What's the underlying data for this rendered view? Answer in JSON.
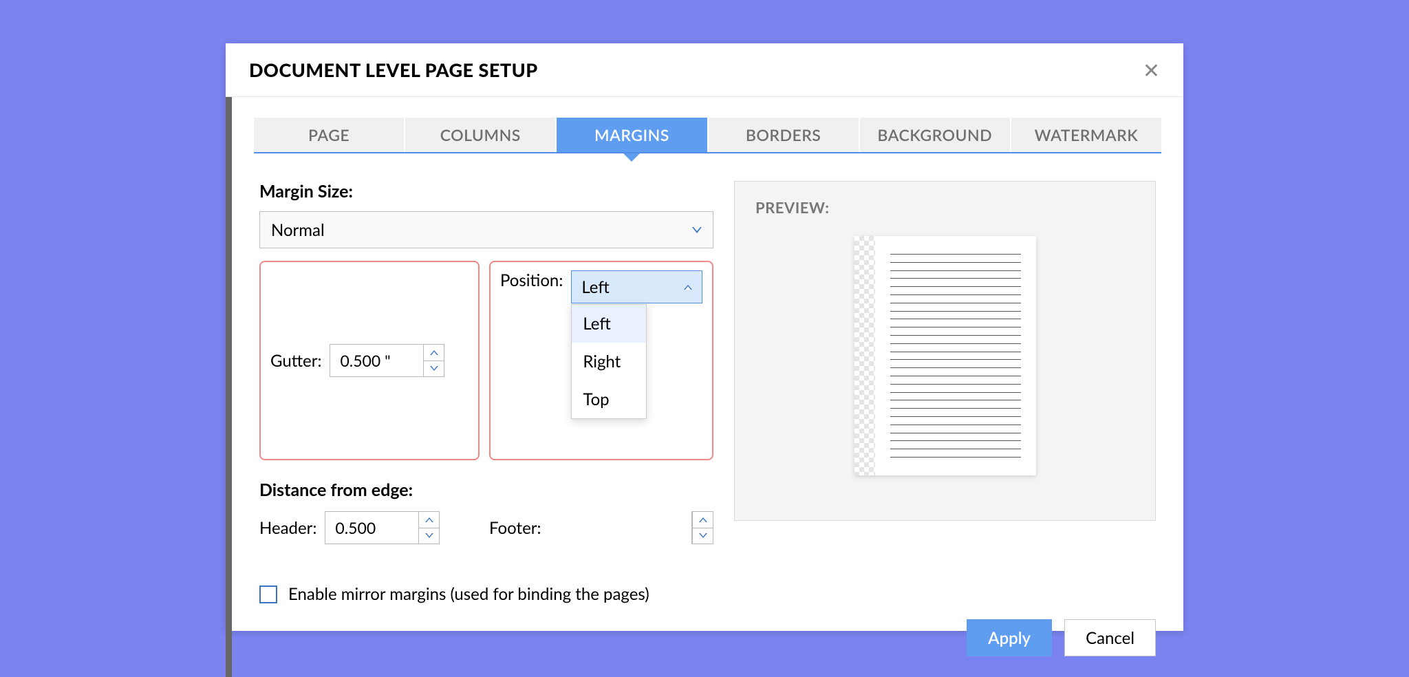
{
  "dialog": {
    "title": "DOCUMENT LEVEL PAGE SETUP"
  },
  "tabs": [
    "PAGE",
    "COLUMNS",
    "MARGINS",
    "BORDERS",
    "BACKGROUND",
    "WATERMARK"
  ],
  "active_tab_index": 2,
  "margins": {
    "size_label": "Margin Size:",
    "size_value": "Normal",
    "gutter_label": "Gutter:",
    "gutter_value": "0.500 \"",
    "position_label": "Position:",
    "position_value": "Left",
    "position_options": [
      "Left",
      "Right",
      "Top"
    ],
    "distance_label": "Distance from edge:",
    "header_label": "Header:",
    "header_value": "0.500",
    "footer_label": "Footer:",
    "mirror_label": "Enable mirror margins (used for binding the pages)"
  },
  "preview": {
    "label": "PREVIEW:"
  },
  "buttons": {
    "apply": "Apply",
    "cancel": "Cancel"
  }
}
